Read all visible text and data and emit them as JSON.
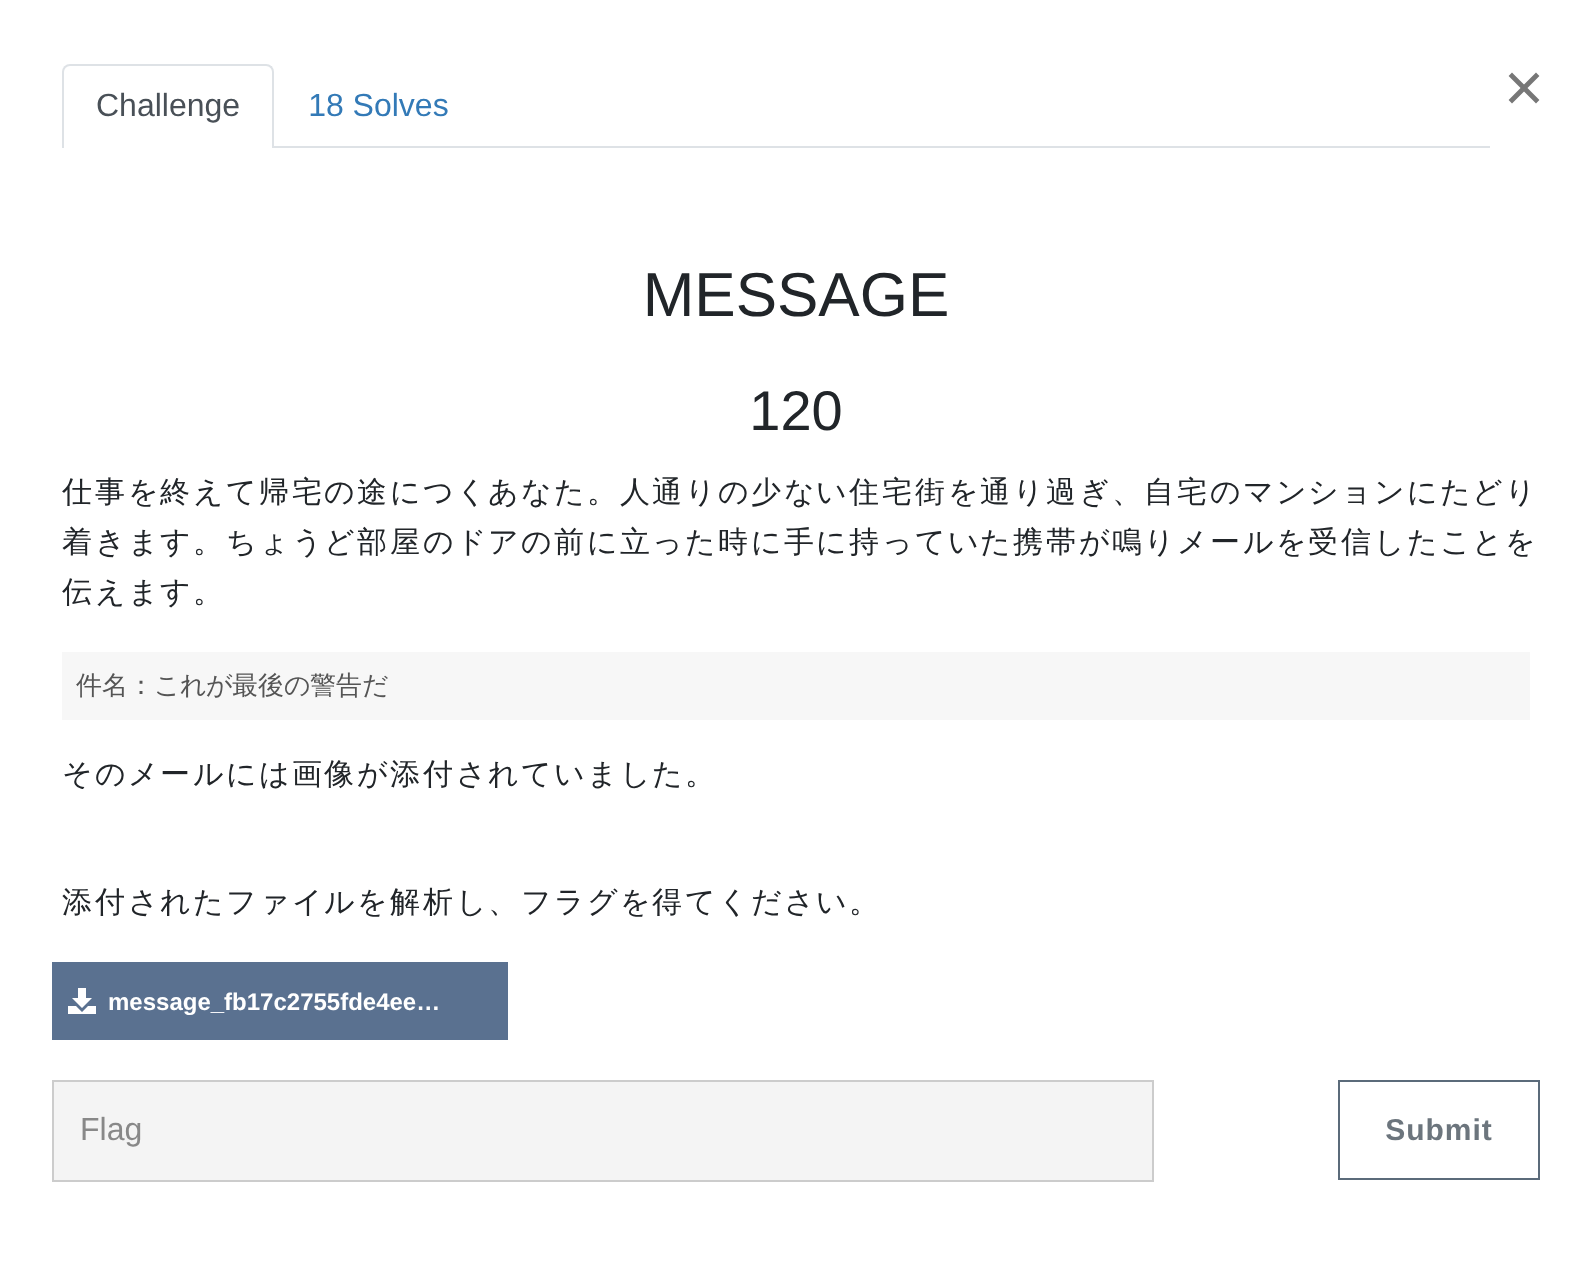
{
  "tabs": [
    {
      "label": "Challenge",
      "selected": true
    },
    {
      "label": "18 Solves",
      "selected": false
    }
  ],
  "challenge": {
    "name": "MESSAGE",
    "value": "120"
  },
  "description": [
    {
      "kind": "paragraph",
      "text": "仕事を終えて帰宅の途につくあなた。人通りの少ない住宅街を通り過ぎ、自宅のマンションにたどり着きます。ちょうど部屋のドアの前に立った時に手に持っていた携帯が鳴りメールを受信したことを伝えます。"
    },
    {
      "kind": "quote",
      "text": "件名：これが最後の警告だ"
    },
    {
      "kind": "paragraph",
      "text": "そのメールには画像が添付されていました。"
    },
    {
      "kind": "paragraph",
      "text": "添付されたファイルを解析し、フラグを得てください。"
    }
  ],
  "files": [
    {
      "name": "message_fb17c2755fde4ee…"
    }
  ],
  "flag_form": {
    "placeholder": "Flag",
    "submit": "Submit"
  }
}
